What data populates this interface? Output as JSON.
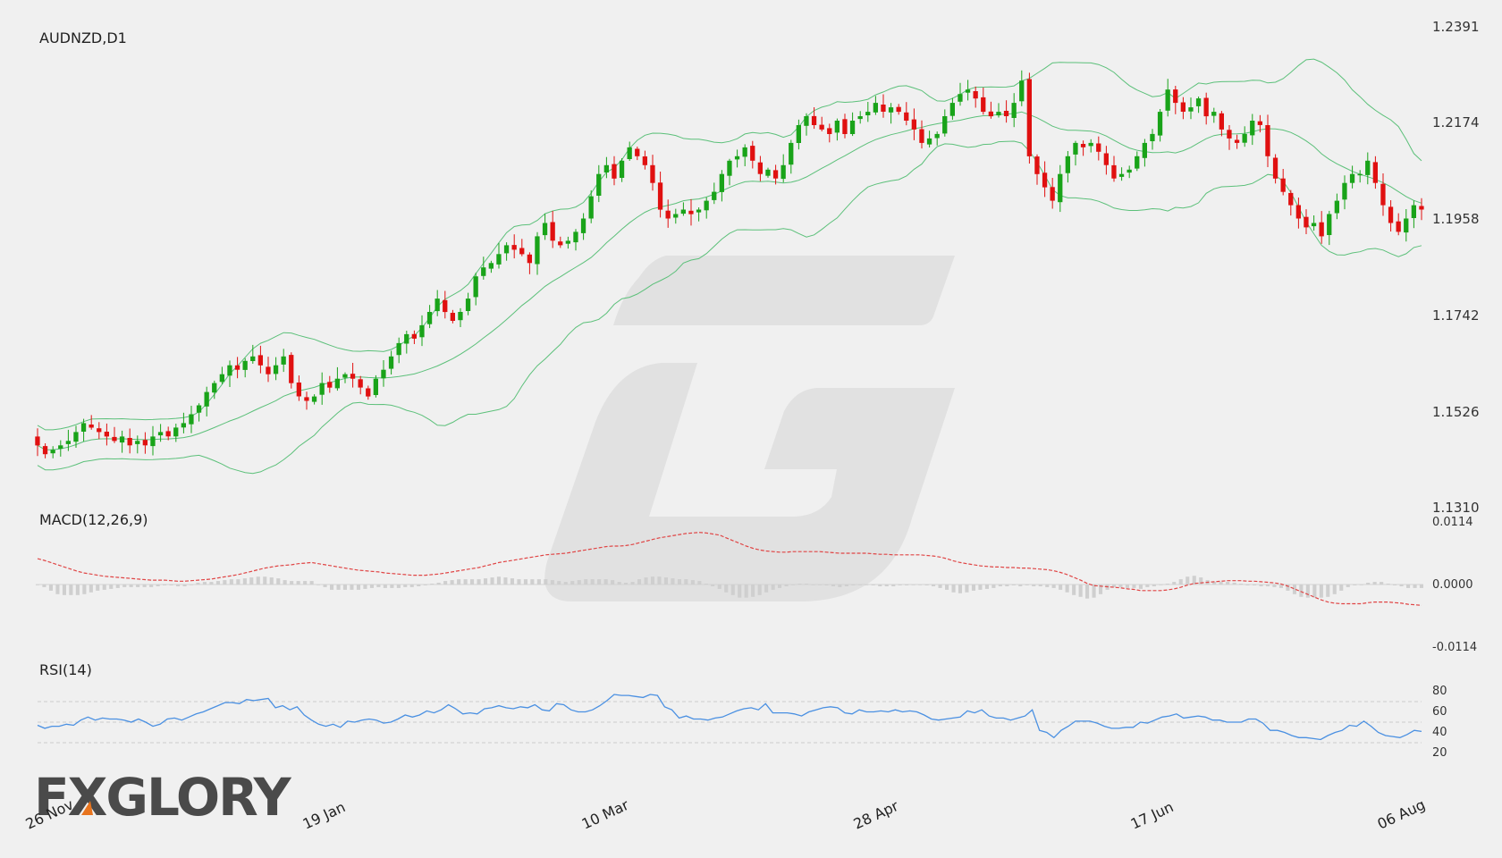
{
  "logo": {
    "text": "FXGLORY"
  },
  "chart_data": [
    {
      "type": "candlestick",
      "title": "AUDNZD,D1",
      "ylim": [
        1.131,
        1.2391
      ],
      "y_ticks": [
        "1.2391",
        "1.2174",
        "1.1958",
        "1.1742",
        "1.1526",
        "1.1310"
      ],
      "x_tick_labels": [
        "26 Nov",
        "19 Jan",
        "10 Mar",
        "28 Apr",
        "17 Jun",
        "06 Aug"
      ],
      "overlays": [
        "Bollinger Bands"
      ],
      "colors": {
        "up": "#19a319",
        "down": "#e01010",
        "bands": "#5cc07a"
      },
      "close": [
        1.145,
        1.143,
        1.144,
        1.145,
        1.146,
        1.148,
        1.15,
        1.149,
        1.148,
        1.147,
        1.146,
        1.147,
        1.145,
        1.146,
        1.145,
        1.147,
        1.148,
        1.147,
        1.149,
        1.15,
        1.152,
        1.154,
        1.157,
        1.159,
        1.161,
        1.163,
        1.162,
        1.164,
        1.165,
        1.163,
        1.161,
        1.163,
        1.165,
        1.159,
        1.156,
        1.155,
        1.156,
        1.159,
        1.158,
        1.16,
        1.161,
        1.16,
        1.158,
        1.156,
        1.16,
        1.162,
        1.165,
        1.168,
        1.17,
        1.169,
        1.172,
        1.175,
        1.178,
        1.175,
        1.173,
        1.175,
        1.178,
        1.183,
        1.185,
        1.186,
        1.188,
        1.19,
        1.189,
        1.188,
        1.186,
        1.192,
        1.195,
        1.191,
        1.19,
        1.191,
        1.193,
        1.196,
        1.201,
        1.206,
        1.208,
        1.205,
        1.209,
        1.212,
        1.21,
        1.208,
        1.204,
        1.198,
        1.196,
        1.197,
        1.198,
        1.197,
        1.198,
        1.2,
        1.202,
        1.206,
        1.209,
        1.21,
        1.212,
        1.209,
        1.206,
        1.207,
        1.205,
        1.208,
        1.213,
        1.217,
        1.219,
        1.217,
        1.216,
        1.215,
        1.218,
        1.215,
        1.218,
        1.219,
        1.22,
        1.222,
        1.22,
        1.221,
        1.22,
        1.218,
        1.216,
        1.213,
        1.214,
        1.215,
        1.219,
        1.222,
        1.224,
        1.225,
        1.223,
        1.22,
        1.219,
        1.22,
        1.219,
        1.222,
        1.227,
        1.21,
        1.206,
        1.203,
        1.2,
        1.206,
        1.21,
        1.213,
        1.212,
        1.213,
        1.211,
        1.208,
        1.205,
        1.206,
        1.207,
        1.21,
        1.213,
        1.215,
        1.22,
        1.225,
        1.222,
        1.22,
        1.221,
        1.223,
        1.219,
        1.22,
        1.216,
        1.214,
        1.213,
        1.215,
        1.218,
        1.217,
        1.21,
        1.205,
        1.202,
        1.199,
        1.196,
        1.194,
        1.195,
        1.192,
        1.197,
        1.2,
        1.204,
        1.206,
        1.206,
        1.209,
        1.204,
        1.199,
        1.195,
        1.193,
        1.196,
        1.199,
        1.198
      ]
    },
    {
      "type": "line+bar",
      "title": "MACD(12,26,9)",
      "ylim": [
        -0.0114,
        0.0114
      ],
      "y_ticks": [
        "0.0114",
        "0.0000",
        "-0.0114"
      ],
      "series": [
        {
          "role": "signal",
          "color": "#e04545",
          "values": [
            0.0047,
            0.0044,
            0.004,
            0.0036,
            0.0032,
            0.0028,
            0.0024,
            0.0021,
            0.0019,
            0.0017,
            0.0015,
            0.0014,
            0.0013,
            0.0012,
            0.0011,
            0.001,
            0.0009,
            0.0008,
            0.0008,
            0.0008,
            0.0007,
            0.0006,
            0.0006,
            0.0007,
            0.0008,
            0.0009,
            0.001,
            0.0012,
            0.0014,
            0.0016,
            0.0018,
            0.0021,
            0.0024,
            0.0027,
            0.003,
            0.0032,
            0.0034,
            0.0035,
            0.0036,
            0.0038,
            0.0039,
            0.004,
            0.0038,
            0.0036,
            0.0034,
            0.0032,
            0.003,
            0.0028,
            0.0026,
            0.0025,
            0.0024,
            0.0023,
            0.0021,
            0.002,
            0.0019,
            0.0018,
            0.0017,
            0.0017,
            0.0017,
            0.0018,
            0.0019,
            0.0021,
            0.0023,
            0.0025,
            0.0027,
            0.0029,
            0.0031,
            0.0034,
            0.0037,
            0.004,
            0.0042,
            0.0044,
            0.0046,
            0.0048,
            0.005,
            0.0052,
            0.0054,
            0.0055,
            0.0056,
            0.0057,
            0.0059,
            0.0061,
            0.0063,
            0.0065,
            0.0067,
            0.0069,
            0.007,
            0.007,
            0.0071,
            0.0073,
            0.0076,
            0.0079,
            0.0082,
            0.0085,
            0.0087,
            0.0089,
            0.0091,
            0.0093,
            0.0094,
            0.0095,
            0.0094,
            0.0092,
            0.009,
            0.0085,
            0.008,
            0.0075,
            0.007,
            0.0066,
            0.0063,
            0.0061,
            0.006,
            0.0059,
            0.0059,
            0.006,
            0.006,
            0.006,
            0.006,
            0.006,
            0.0059,
            0.0058,
            0.0057,
            0.0057,
            0.0057,
            0.0057,
            0.0057,
            0.0056,
            0.0055,
            0.0055,
            0.0054,
            0.0054,
            0.0054,
            0.0054,
            0.0054,
            0.0053,
            0.0052,
            0.005,
            0.0047,
            0.0043,
            0.004,
            0.0038,
            0.0036,
            0.0034,
            0.0033,
            0.0032,
            0.0032,
            0.0031,
            0.0031,
            0.003,
            0.003,
            0.0029,
            0.0028,
            0.0027,
            0.0025,
            0.0022,
            0.0018,
            0.0013,
            0.0008,
            0.0002,
            -0.0002,
            -0.0003,
            -0.0004,
            -0.0005,
            -0.0006,
            -0.0008,
            -0.0009,
            -0.0011,
            -0.0011,
            -0.0011,
            -0.0011,
            -0.001,
            -0.0008,
            -0.0005,
            -0.0001,
            0.0002,
            0.0003,
            0.0004,
            0.0005,
            0.0006,
            0.0007,
            0.0007,
            0.0007,
            0.0006,
            0.0006,
            0.0005,
            0.0004,
            0.0003,
            0.0001,
            -0.0003,
            -0.0008,
            -0.0013,
            -0.0018,
            -0.0023,
            -0.0028,
            -0.0032,
            -0.0034,
            -0.0035,
            -0.0035,
            -0.0035,
            -0.0035,
            -0.0033,
            -0.0032,
            -0.0032,
            -0.0032,
            -0.0033,
            -0.0034,
            -0.0036,
            -0.0037,
            -0.0038
          ]
        }
      ]
    },
    {
      "type": "line",
      "title": "RSI(14)",
      "ylim": [
        10,
        90
      ],
      "y_ticks": [
        "80",
        "60",
        "40",
        "20"
      ],
      "levels": [
        70,
        50,
        30
      ],
      "series": [
        {
          "color": "#4a90e2",
          "values": [
            47,
            44,
            46,
            46,
            48,
            47,
            52,
            55,
            52,
            54,
            53,
            53,
            52,
            50,
            53,
            50,
            46,
            48,
            53,
            54,
            52,
            55,
            58,
            60,
            63,
            66,
            69,
            69,
            68,
            72,
            71,
            72,
            73,
            64,
            66,
            62,
            65,
            57,
            52,
            48,
            46,
            48,
            45,
            51,
            50,
            52,
            53,
            52,
            49,
            50,
            53,
            57,
            55,
            57,
            61,
            59,
            62,
            67,
            63,
            58,
            59,
            58,
            63,
            64,
            66,
            64,
            63,
            65,
            64,
            67,
            62,
            61,
            68,
            67,
            62,
            60,
            60,
            62,
            66,
            71,
            77,
            76,
            76,
            75,
            74,
            77,
            76,
            65,
            62,
            54,
            56,
            53,
            53,
            52,
            54,
            55,
            58,
            61,
            63,
            64,
            62,
            68,
            59,
            59,
            59,
            58,
            56,
            60,
            62,
            64,
            65,
            64,
            59,
            58,
            62,
            60,
            60,
            61,
            60,
            62,
            60,
            61,
            60,
            57,
            53,
            52,
            53,
            54,
            55,
            61,
            59,
            62,
            56,
            54,
            54,
            52,
            54,
            56,
            62,
            42,
            40,
            35,
            42,
            46,
            51,
            51,
            51,
            49,
            46,
            44,
            44,
            45,
            45,
            50,
            49,
            52,
            55,
            56,
            58,
            54,
            55,
            56,
            55,
            52,
            52,
            50,
            50,
            50,
            53,
            53,
            49,
            42,
            42,
            40,
            37,
            35,
            35,
            34,
            33,
            37,
            40,
            42,
            47,
            46,
            51,
            46,
            40,
            37,
            36,
            35,
            38,
            42,
            41
          ]
        }
      ]
    }
  ]
}
